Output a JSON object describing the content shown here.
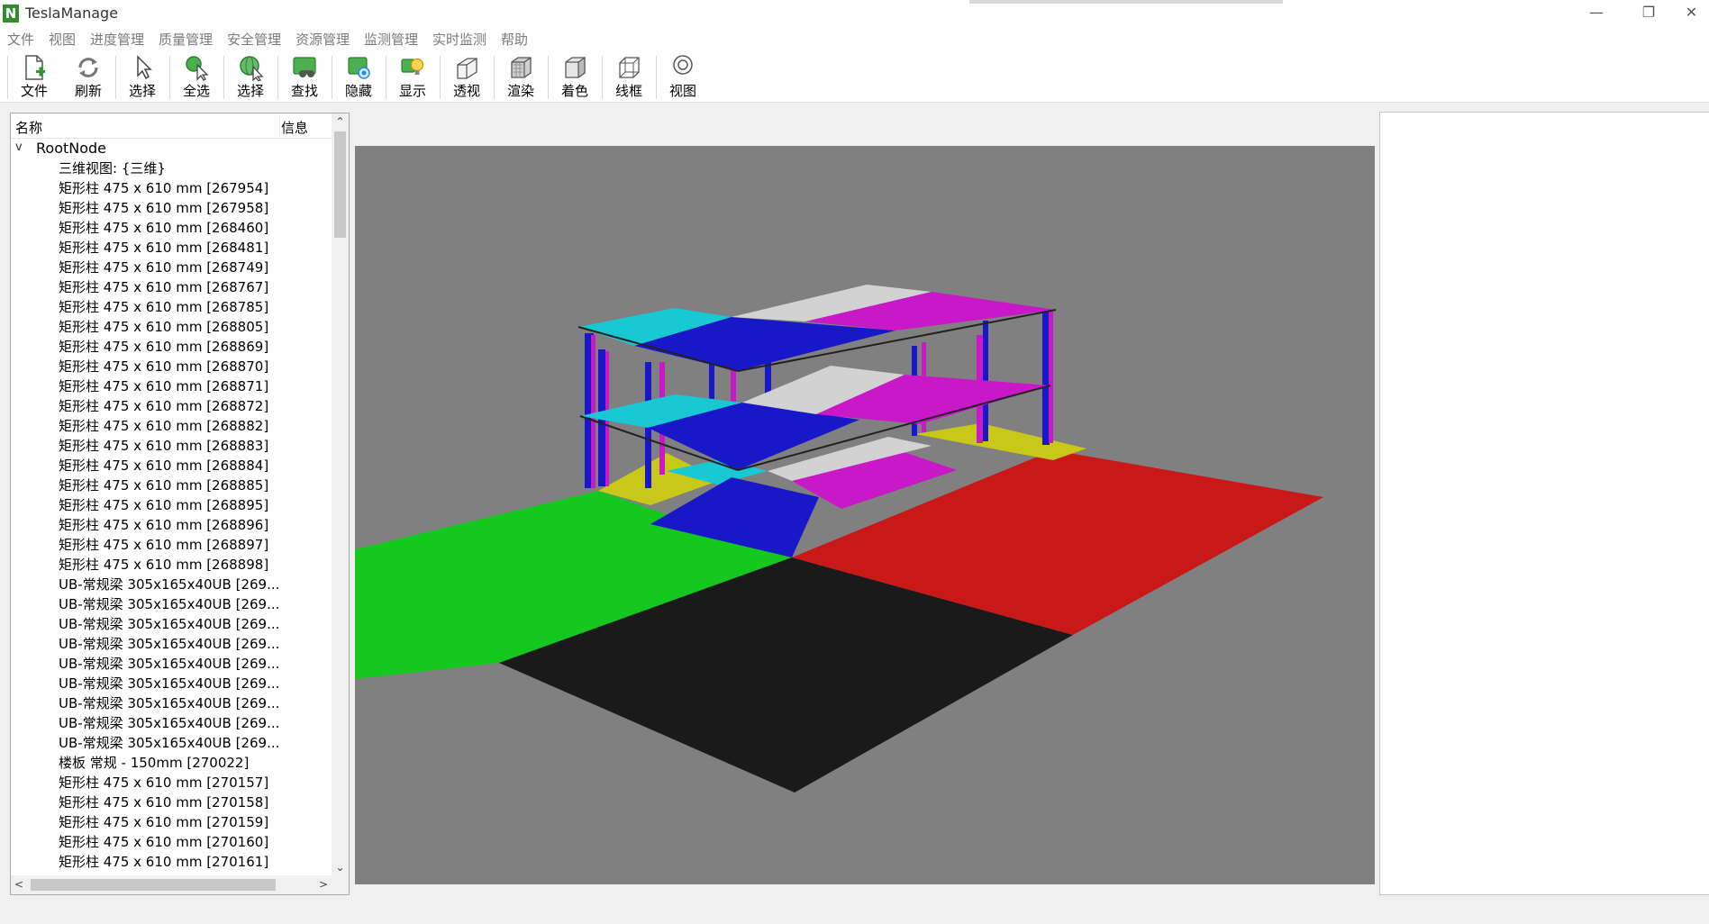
{
  "window": {
    "title": "TeslaManage",
    "logo_letter": "N",
    "controls": {
      "minimize": "—",
      "restore": "❐",
      "close": "✕"
    }
  },
  "menu": {
    "items": [
      "文件",
      "视图",
      "进度管理",
      "质量管理",
      "安全管理",
      "资源管理",
      "监测管理",
      "实时监测",
      "帮助"
    ]
  },
  "toolbar": {
    "buttons": [
      {
        "label": "文件",
        "icon": "new-file-icon"
      },
      {
        "label": "刷新",
        "icon": "refresh-icon"
      },
      {
        "label": "选择",
        "icon": "cursor-icon"
      },
      {
        "label": "全选",
        "icon": "select-all-icon"
      },
      {
        "label": "选择",
        "icon": "select-globe-icon"
      },
      {
        "label": "查找",
        "icon": "binoculars-icon"
      },
      {
        "label": "隐藏",
        "icon": "hide-icon"
      },
      {
        "label": "显示",
        "icon": "show-bulb-icon"
      },
      {
        "label": "透视",
        "icon": "perspective-icon"
      },
      {
        "label": "渲染",
        "icon": "render-icon"
      },
      {
        "label": "着色",
        "icon": "shade-icon"
      },
      {
        "label": "线框",
        "icon": "wireframe-icon"
      },
      {
        "label": "视图",
        "icon": "view-icon"
      }
    ]
  },
  "tree": {
    "header_name": "名称",
    "header_info": "信息",
    "root_label": "RootNode",
    "root_chevron": "v",
    "items": [
      "三维视图: {三维}",
      "矩形柱 475 x 610 mm [267954]",
      "矩形柱 475 x 610 mm [267958]",
      "矩形柱 475 x 610 mm [268460]",
      "矩形柱 475 x 610 mm [268481]",
      "矩形柱 475 x 610 mm [268749]",
      "矩形柱 475 x 610 mm [268767]",
      "矩形柱 475 x 610 mm [268785]",
      "矩形柱 475 x 610 mm [268805]",
      "矩形柱 475 x 610 mm [268869]",
      "矩形柱 475 x 610 mm [268870]",
      "矩形柱 475 x 610 mm [268871]",
      "矩形柱 475 x 610 mm [268872]",
      "矩形柱 475 x 610 mm [268882]",
      "矩形柱 475 x 610 mm [268883]",
      "矩形柱 475 x 610 mm [268884]",
      "矩形柱 475 x 610 mm [268885]",
      "矩形柱 475 x 610 mm [268895]",
      "矩形柱 475 x 610 mm [268896]",
      "矩形柱 475 x 610 mm [268897]",
      "矩形柱 475 x 610 mm [268898]",
      "UB-常规梁 305x165x40UB [269...",
      "UB-常规梁 305x165x40UB [269...",
      "UB-常规梁 305x165x40UB [269...",
      "UB-常规梁 305x165x40UB [269...",
      "UB-常规梁 305x165x40UB [269...",
      "UB-常规梁 305x165x40UB [269...",
      "UB-常规梁 305x165x40UB [269...",
      "UB-常规梁 305x165x40UB [269...",
      "UB-常规梁 305x165x40UB [269...",
      "楼板 常规 - 150mm [270022]",
      "矩形柱 475 x 610 mm [270157]",
      "矩形柱 475 x 610 mm [270158]",
      "矩形柱 475 x 610 mm [270159]",
      "矩形柱 475 x 610 mm [270160]",
      "矩形柱 475 x 610 mm [270161]"
    ],
    "scroll": {
      "up": "⌃",
      "down": "⌄",
      "left": "<",
      "right": ">"
    }
  },
  "viewport": {
    "background": "#808080",
    "colors": {
      "green": "#14c81e",
      "black": "#1a1a1a",
      "red": "#c81818",
      "blue": "#1818c8",
      "cyan": "#18c8d2",
      "magenta": "#c818c8",
      "yellow": "#c8c818",
      "white": "#d2d2d2"
    }
  }
}
